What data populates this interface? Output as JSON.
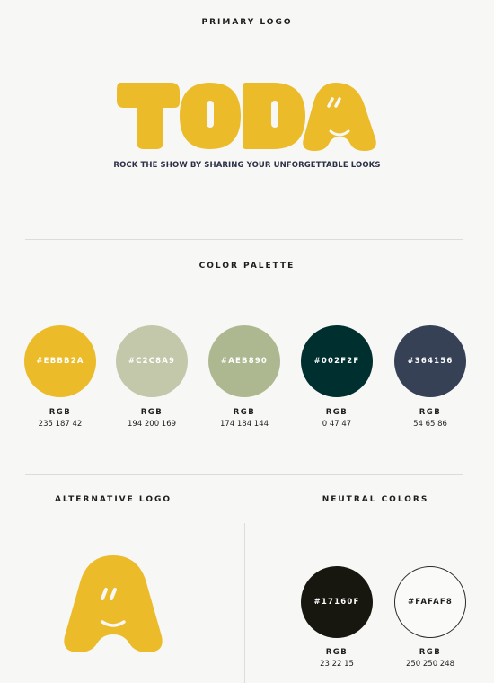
{
  "primary_logo": {
    "heading": "PRIMARY LOGO",
    "wordmark": "TODA",
    "tagline": "ROCK THE SHOW BY SHARING YOUR UNFORGETTABLE LOOKS",
    "brand_color": "#EBBB2A"
  },
  "color_palette": {
    "heading": "COLOR PALETTE",
    "swatches": [
      {
        "hex": "#EBBB2A",
        "rgb_label": "RGB",
        "rgb": "235 187 42",
        "color": "#EBBB2A"
      },
      {
        "hex": "#C2C8A9",
        "rgb_label": "RGB",
        "rgb": "194 200 169",
        "color": "#C2C8A9"
      },
      {
        "hex": "#AEB890",
        "rgb_label": "RGB",
        "rgb": "174 184 144",
        "color": "#AEB890"
      },
      {
        "hex": "#002F2F",
        "rgb_label": "RGB",
        "rgb": "0 47 47",
        "color": "#002F2F"
      },
      {
        "hex": "#364156",
        "rgb_label": "RGB",
        "rgb": "54 65 86",
        "color": "#364156"
      }
    ]
  },
  "alternative_logo": {
    "heading": "ALTERNATIVE LOGO"
  },
  "neutral_colors": {
    "heading": "NEUTRAL COLORS",
    "swatches": [
      {
        "hex": "#17160F",
        "rgb_label": "RGB",
        "rgb": "23 22 15",
        "color": "#17160F"
      },
      {
        "hex": "#FAFAF8",
        "rgb_label": "RGB",
        "rgb": "250 250 248",
        "color": "#FAFAF8"
      }
    ]
  }
}
